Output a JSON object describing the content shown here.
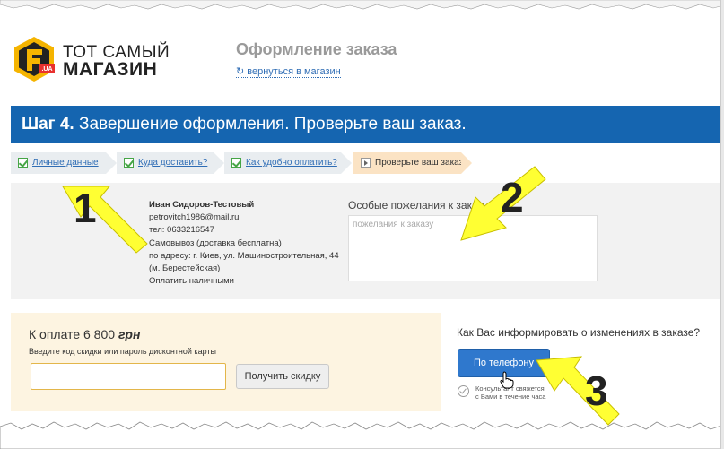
{
  "header": {
    "logo_line1": "ТОТ САМЫЙ",
    "logo_line2": "МАГАЗИН",
    "logo_badge": ".UA",
    "page_title": "Оформление заказа",
    "back_link": "вернуться в магазин"
  },
  "banner": {
    "step_bold": "Шаг 4.",
    "step_text": " Завершение оформления. Проверьте ваш заказ."
  },
  "steps": [
    {
      "label": "Личные данные",
      "done": true
    },
    {
      "label": "Куда доставить?",
      "done": true
    },
    {
      "label": "Как удобно оплатить?",
      "done": true
    },
    {
      "label": "Проверьте ваш заказ.",
      "done": false
    }
  ],
  "customer": {
    "name": "Иван Сидоров-Тестовый",
    "email": "petrovitch1986@mail.ru",
    "phone": "тел: 0633216547",
    "delivery": "Самовывоз (доставка бесплатна)",
    "address_line1": "по адресу: г. Киев, ул. Машиностроительная, 44",
    "address_line2": "(м. Берестейская)",
    "payment": "Оплатить наличными"
  },
  "wishes": {
    "label": "Особые пожелания к заказу",
    "placeholder": "пожелания к заказу"
  },
  "payment": {
    "title_prefix": "К оплате ",
    "amount": "6 800",
    "currency": "грн",
    "code_label": "Введите код скидки или пароль дисконтной карты",
    "discount_button": "Получить скидку"
  },
  "notify": {
    "question": "Как Вас информировать о изменениях в заказе?",
    "phone_button": "По телефону",
    "note_line1": "Консультант свяжется",
    "note_line2": "с Вами в течение часа"
  },
  "annotations": [
    "1",
    "2",
    "3"
  ],
  "colors": {
    "banner": "#1565b0",
    "link": "#2f6db5",
    "callout": "#ffff33",
    "phone_button": "#2f78cd"
  }
}
